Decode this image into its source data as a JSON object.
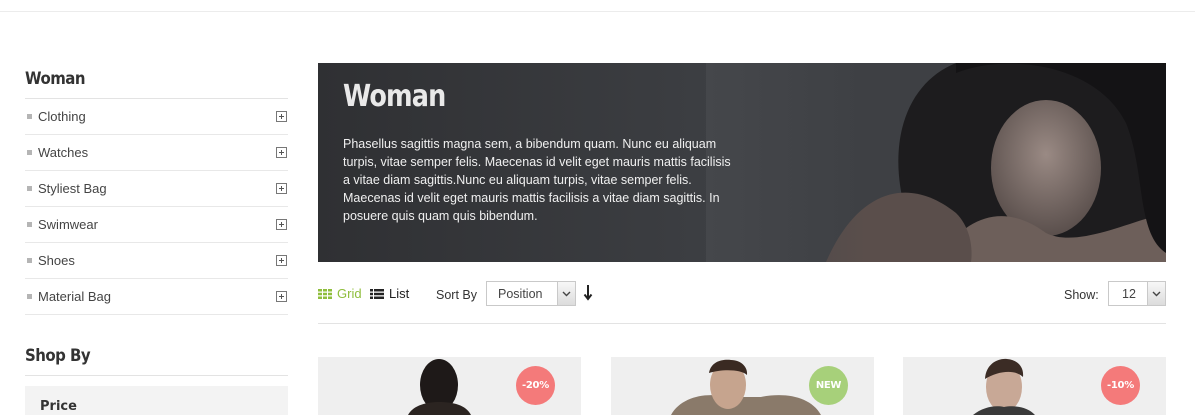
{
  "sidebar": {
    "category_title": "Woman",
    "categories": [
      {
        "label": "Clothing"
      },
      {
        "label": "Watches"
      },
      {
        "label": "Styliest Bag"
      },
      {
        "label": "Swimwear"
      },
      {
        "label": "Shoes"
      },
      {
        "label": "Material Bag"
      }
    ],
    "shopby_title": "Shop By",
    "price_label": "Price"
  },
  "banner": {
    "title": "Woman",
    "description": "Phasellus sagittis magna sem, a bibendum quam. Nunc eu aliquam turpis, vitae semper felis. Maecenas id velit eget mauris mattis facilisis a vitae diam sagittis.Nunc eu aliquam turpis, vitae semper felis. Maecenas id velit eget mauris mattis facilisis a vitae diam sagittis. In posuere quis quam quis bibendum."
  },
  "toolbar": {
    "grid_label": "Grid",
    "list_label": "List",
    "sort_label": "Sort By",
    "sort_value": "Position",
    "show_label": "Show:",
    "limit_value": "12"
  },
  "products": [
    {
      "badge": "-20%",
      "badge_type": "sale"
    },
    {
      "badge": "NEW",
      "badge_type": "new"
    },
    {
      "badge": "-10%",
      "badge_type": "sale"
    }
  ],
  "colors": {
    "accent_green": "#8fbe3c",
    "badge_sale": "#f47a7a",
    "badge_new": "#a7d07a",
    "banner_bg": "#3c3e42"
  }
}
